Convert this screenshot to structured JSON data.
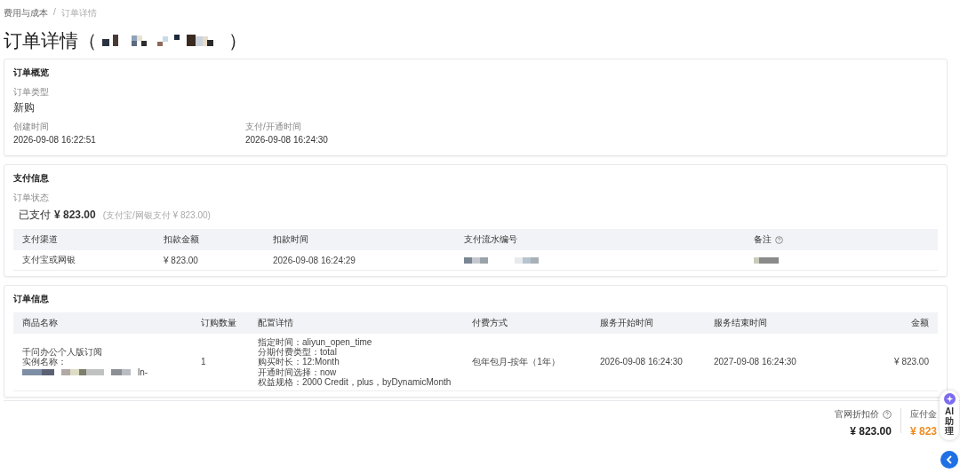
{
  "breadcrumb": {
    "items": [
      "费用与成本",
      "订单详情"
    ],
    "separator": "/"
  },
  "page_title": {
    "text": "订单详情（",
    "close": "）"
  },
  "overview": {
    "heading": "订单概览",
    "rows": [
      [
        {
          "label": "订单类型",
          "value": "新购",
          "kind": "large"
        }
      ],
      [
        {
          "label": "创建时间",
          "value": "2026-09-08 16:22:51",
          "kind": "normal"
        },
        {
          "label": "支付/开通时间",
          "value": "2026-09-08 16:24:30",
          "kind": "normal"
        }
      ]
    ]
  },
  "payment": {
    "heading": "支付信息",
    "status_label": "订单状态",
    "status": "已支付",
    "amount": "¥ 823.00",
    "note": "(支付宝/网银支付 ¥ 823.00)",
    "columns": [
      {
        "label": "支付渠道",
        "help": false
      },
      {
        "label": "扣款金额",
        "help": false
      },
      {
        "label": "扣款时间",
        "help": false
      },
      {
        "label": "支付流水编号",
        "help": false
      },
      {
        "label": "备注",
        "help": true
      }
    ],
    "rows": [
      {
        "cells": [
          {
            "kind": "text",
            "text": "支付宝或网银"
          },
          {
            "kind": "text",
            "text": "¥ 823.00"
          },
          {
            "kind": "text",
            "text": "2026-09-08 16:24:29"
          },
          {
            "kind": "redacted"
          },
          {
            "kind": "redacted"
          }
        ]
      }
    ]
  },
  "order": {
    "heading": "订单信息",
    "columns": [
      "商品名称",
      "订购数量",
      "配置详情",
      "付费方式",
      "服务开始时间",
      "服务结束时间",
      "金额"
    ],
    "rows": [
      {
        "product": "千问办公个人版订阅",
        "instance_label": "实例名称：",
        "instance_suffix": "ln-",
        "quantity": "1",
        "config": [
          "指定时间：aliyun_open_time",
          "分期付费类型：total",
          "购买时长：12:Month",
          "开通时间选择：now",
          "权益规格：2000 Credit，plus，byDynamicMonth"
        ],
        "billing": "包年包月-按年（1年）",
        "start": "2026-09-08 16:24:30",
        "end": "2027-09-08 16:24:30",
        "amount": "¥ 823.00"
      }
    ]
  },
  "footer": {
    "list_price_label": "官网折扣价",
    "list_price": "¥ 823.00",
    "due_label": "应付金",
    "due": "¥ 823"
  },
  "assistant": {
    "label": "AI助理"
  }
}
